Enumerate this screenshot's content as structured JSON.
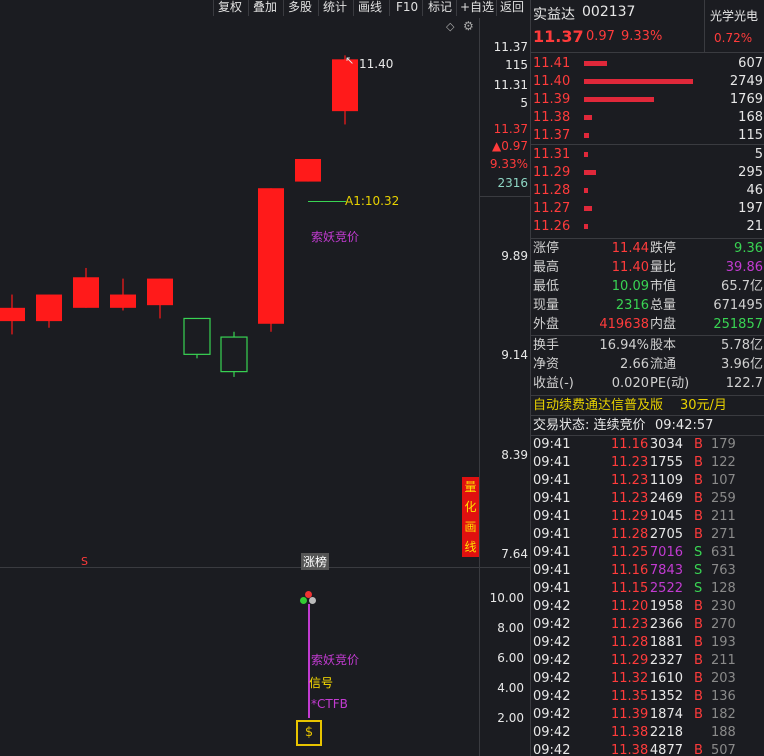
{
  "toolbar": {
    "items": [
      "复权",
      "叠加",
      "多股",
      "统计",
      "画线",
      "F10",
      "标记",
      "+自选",
      "返回"
    ],
    "diamond": "◇",
    "gear": "⚙"
  },
  "stock": {
    "name": "实益达",
    "code": "002137",
    "price": "11.37",
    "change": "0.97",
    "change_pct": "9.33%",
    "sector": "光学光电",
    "sector_pct": "0.72%"
  },
  "axis": {
    "top_price": "11.37",
    "top_vol": "115",
    "p2": "11.31",
    "v2": "5",
    "info_price": "11.37",
    "info_change": "▲0.97",
    "info_pct": "9.33%",
    "info_vol": "2316",
    "levels": [
      "9.89",
      "9.14",
      "8.39",
      "7.64"
    ],
    "sub_levels": [
      "10.00",
      "8.00",
      "6.00",
      "4.00",
      "2.00"
    ]
  },
  "chart_labels": {
    "high_label": "11.40",
    "a1_label": "A1:10.32",
    "tag1": "索妖竞价",
    "zhangbang": "涨榜",
    "s_mark": "S",
    "vertical_tool": [
      "量",
      "化",
      "画",
      "线"
    ],
    "sub_tag1": "索妖竞价",
    "sub_tag2": "信号",
    "sub_tag3": "*CTFB"
  },
  "chart_data": {
    "type": "candlestick",
    "candles": [
      {
        "open": 9.5,
        "close": 9.4,
        "high": 9.6,
        "low": 9.3
      },
      {
        "open": 9.6,
        "close": 9.4,
        "high": 9.6,
        "low": 9.35
      },
      {
        "open": 9.73,
        "close": 9.5,
        "high": 9.8,
        "low": 9.5
      },
      {
        "open": 9.6,
        "close": 9.5,
        "high": 9.72,
        "low": 9.48
      },
      {
        "open": 9.72,
        "close": 9.52,
        "high": 9.72,
        "low": 9.42
      },
      {
        "open": 9.15,
        "close": 9.42,
        "high": 9.42,
        "low": 9.12,
        "rising": true
      },
      {
        "open": 9.02,
        "close": 9.28,
        "high": 9.32,
        "low": 8.98,
        "rising": true
      },
      {
        "open": 9.38,
        "close": 10.4,
        "high": 10.4,
        "low": 9.32
      },
      {
        "open": 10.62,
        "close": 10.45,
        "high": 10.62,
        "low": 10.45
      },
      {
        "open": 10.98,
        "close": 11.37,
        "high": 11.4,
        "low": 10.88
      }
    ],
    "ylim": [
      7.64,
      11.5
    ]
  },
  "orderbook": {
    "asks": [
      {
        "price": "11.41",
        "vol": "607",
        "bar": 0.09
      },
      {
        "price": "11.40",
        "vol": "2749",
        "bar": 0.42
      },
      {
        "price": "11.39",
        "vol": "1769",
        "bar": 0.27
      },
      {
        "price": "11.38",
        "vol": "168",
        "bar": 0.03
      },
      {
        "price": "11.37",
        "vol": "115",
        "bar": 0.02
      }
    ],
    "bids": [
      {
        "price": "11.31",
        "vol": "5",
        "bar": 0.008
      },
      {
        "price": "11.29",
        "vol": "295",
        "bar": 0.045
      },
      {
        "price": "11.28",
        "vol": "46",
        "bar": 0.01
      },
      {
        "price": "11.27",
        "vol": "197",
        "bar": 0.03
      },
      {
        "price": "11.26",
        "vol": "21",
        "bar": 0.008
      }
    ]
  },
  "stats": {
    "zt_l": "涨停",
    "zt_v": "11.44",
    "dt_l": "跌停",
    "dt_v": "9.36",
    "zg_l": "最高",
    "zg_v": "11.40",
    "lb_l": "量比",
    "lb_v": "39.86",
    "zd_l": "最低",
    "zd_v": "10.09",
    "sz_l": "市值",
    "sz_v": "65.7亿",
    "xl_l": "现量",
    "xl_v": "2316",
    "zl_l": "总量",
    "zl_v": "671495",
    "wp_l": "外盘",
    "wp_v": "419638",
    "np_l": "内盘",
    "np_v": "251857",
    "hs_l": "换手",
    "hs_v": "16.94%",
    "gb_l": "股本",
    "gb_v": "5.78亿",
    "jz_l": "净资",
    "jz_v": "2.66",
    "lt_l": "流通",
    "lt_v": "3.96亿",
    "sy_l": "收益(-)",
    "sy_v": "0.020",
    "pe_l": "PE(动)",
    "pe_v": "122.7"
  },
  "promo": {
    "text": "自动续费通达信普及版",
    "price": "30元/月"
  },
  "trade_status": {
    "label": "交易状态: 连续竞价",
    "time": "09:42:57"
  },
  "ticks": [
    {
      "t": "09:41",
      "p": "11.16",
      "v": "3034",
      "s": "B",
      "n": "179"
    },
    {
      "t": "09:41",
      "p": "11.23",
      "v": "1755",
      "s": "B",
      "n": "122"
    },
    {
      "t": "09:41",
      "p": "11.23",
      "v": "1109",
      "s": "B",
      "n": "107"
    },
    {
      "t": "09:41",
      "p": "11.23",
      "v": "2469",
      "s": "B",
      "n": "259"
    },
    {
      "t": "09:41",
      "p": "11.29",
      "v": "1045",
      "s": "B",
      "n": "211"
    },
    {
      "t": "09:41",
      "p": "11.28",
      "v": "2705",
      "s": "B",
      "n": "271"
    },
    {
      "t": "09:41",
      "p": "11.25",
      "v": "7016",
      "s": "S",
      "n": "631"
    },
    {
      "t": "09:41",
      "p": "11.16",
      "v": "7843",
      "s": "S",
      "n": "763"
    },
    {
      "t": "09:41",
      "p": "11.15",
      "v": "2522",
      "s": "S",
      "n": "128"
    },
    {
      "t": "09:42",
      "p": "11.20",
      "v": "1958",
      "s": "B",
      "n": "230"
    },
    {
      "t": "09:42",
      "p": "11.23",
      "v": "2366",
      "s": "B",
      "n": "270"
    },
    {
      "t": "09:42",
      "p": "11.28",
      "v": "1881",
      "s": "B",
      "n": "193"
    },
    {
      "t": "09:42",
      "p": "11.29",
      "v": "2327",
      "s": "B",
      "n": "211"
    },
    {
      "t": "09:42",
      "p": "11.32",
      "v": "1610",
      "s": "B",
      "n": "203"
    },
    {
      "t": "09:42",
      "p": "11.35",
      "v": "1352",
      "s": "B",
      "n": "136"
    },
    {
      "t": "09:42",
      "p": "11.39",
      "v": "1874",
      "s": "B",
      "n": "182"
    },
    {
      "t": "09:42",
      "p": "11.38",
      "v": "2218",
      "s": "",
      "n": "188"
    },
    {
      "t": "09:42",
      "p": "11.38",
      "v": "4877",
      "s": "B",
      "n": "507"
    }
  ],
  "colors": {
    "up": "#ff1a1a",
    "down": "#39d353",
    "bg": "#1b1c21",
    "purple": "#c23bd1"
  }
}
